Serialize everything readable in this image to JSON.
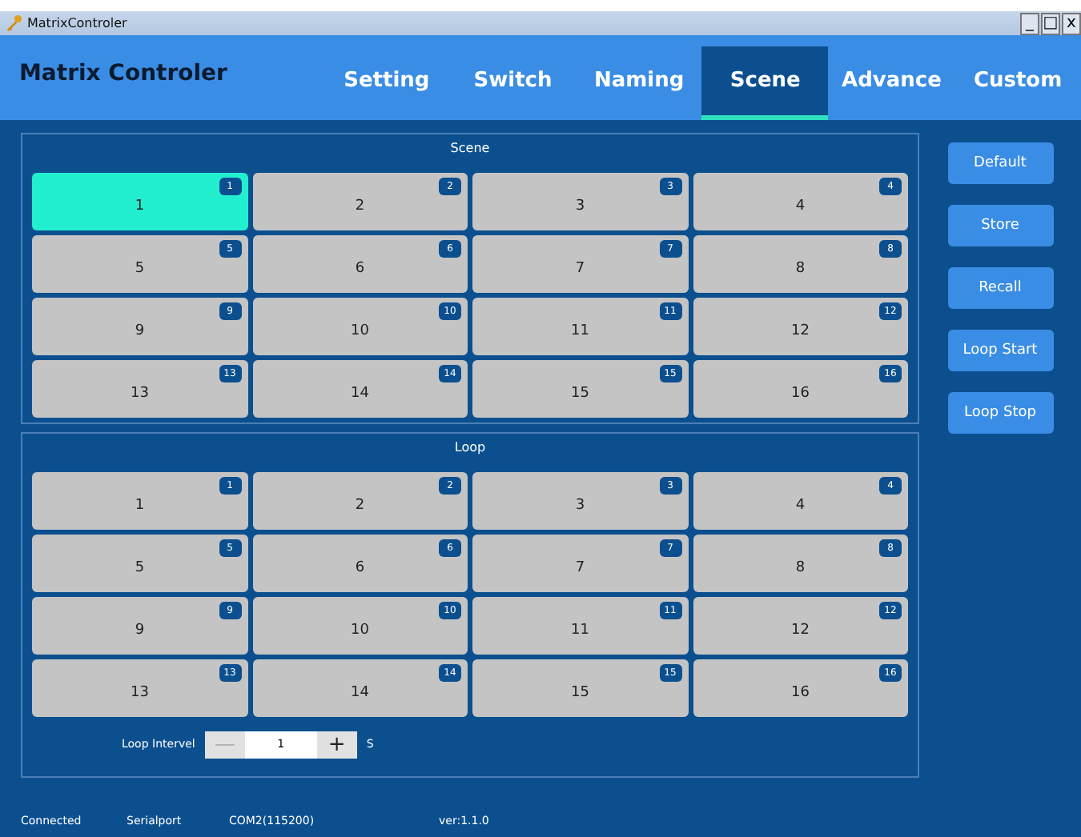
{
  "window": {
    "title": "MatrixControler",
    "controls": [
      "_",
      "□",
      "x"
    ]
  },
  "header": {
    "app_title": "Matrix Controler",
    "tabs": [
      {
        "label": "Setting",
        "selected": false
      },
      {
        "label": "Switch",
        "selected": false
      },
      {
        "label": "Naming",
        "selected": false
      },
      {
        "label": "Scene",
        "selected": true
      },
      {
        "label": "Advance",
        "selected": false
      },
      {
        "label": "Custom",
        "selected": false
      }
    ]
  },
  "scene": {
    "title": "Scene",
    "cells": [
      {
        "label": "1",
        "badge": "1",
        "selected": true
      },
      {
        "label": "2",
        "badge": "2",
        "selected": false
      },
      {
        "label": "3",
        "badge": "3",
        "selected": false
      },
      {
        "label": "4",
        "badge": "4",
        "selected": false
      },
      {
        "label": "5",
        "badge": "5",
        "selected": false
      },
      {
        "label": "6",
        "badge": "6",
        "selected": false
      },
      {
        "label": "7",
        "badge": "7",
        "selected": false
      },
      {
        "label": "8",
        "badge": "8",
        "selected": false
      },
      {
        "label": "9",
        "badge": "9",
        "selected": false
      },
      {
        "label": "10",
        "badge": "10",
        "selected": false
      },
      {
        "label": "11",
        "badge": "11",
        "selected": false
      },
      {
        "label": "12",
        "badge": "12",
        "selected": false
      },
      {
        "label": "13",
        "badge": "13",
        "selected": false
      },
      {
        "label": "14",
        "badge": "14",
        "selected": false
      },
      {
        "label": "15",
        "badge": "15",
        "selected": false
      },
      {
        "label": "16",
        "badge": "16",
        "selected": false
      }
    ]
  },
  "actions": [
    "Default",
    "Store",
    "Recall",
    "Loop Start",
    "Loop Stop"
  ],
  "loop": {
    "title": "Loop",
    "cells": [
      {
        "label": "1",
        "badge": "1",
        "selected": false
      },
      {
        "label": "2",
        "badge": "2",
        "selected": false
      },
      {
        "label": "3",
        "badge": "3",
        "selected": false
      },
      {
        "label": "4",
        "badge": "4",
        "selected": false
      },
      {
        "label": "5",
        "badge": "5",
        "selected": false
      },
      {
        "label": "6",
        "badge": "6",
        "selected": false
      },
      {
        "label": "7",
        "badge": "7",
        "selected": false
      },
      {
        "label": "8",
        "badge": "8",
        "selected": false
      },
      {
        "label": "9",
        "badge": "9",
        "selected": false
      },
      {
        "label": "10",
        "badge": "10",
        "selected": false
      },
      {
        "label": "11",
        "badge": "11",
        "selected": false
      },
      {
        "label": "12",
        "badge": "12",
        "selected": false
      },
      {
        "label": "13",
        "badge": "13",
        "selected": false
      },
      {
        "label": "14",
        "badge": "14",
        "selected": false
      },
      {
        "label": "15",
        "badge": "15",
        "selected": false
      },
      {
        "label": "16",
        "badge": "16",
        "selected": false
      }
    ],
    "interval": {
      "label": "Loop Intervel",
      "minus": {
        "text": "—",
        "disabled": true
      },
      "value": "1",
      "plus": {
        "text": "+",
        "disabled": false
      },
      "unit": "S"
    }
  },
  "status_bar": [
    "Connected",
    "Serialport",
    "COM2(115200)",
    "ver:1.1.0"
  ]
}
